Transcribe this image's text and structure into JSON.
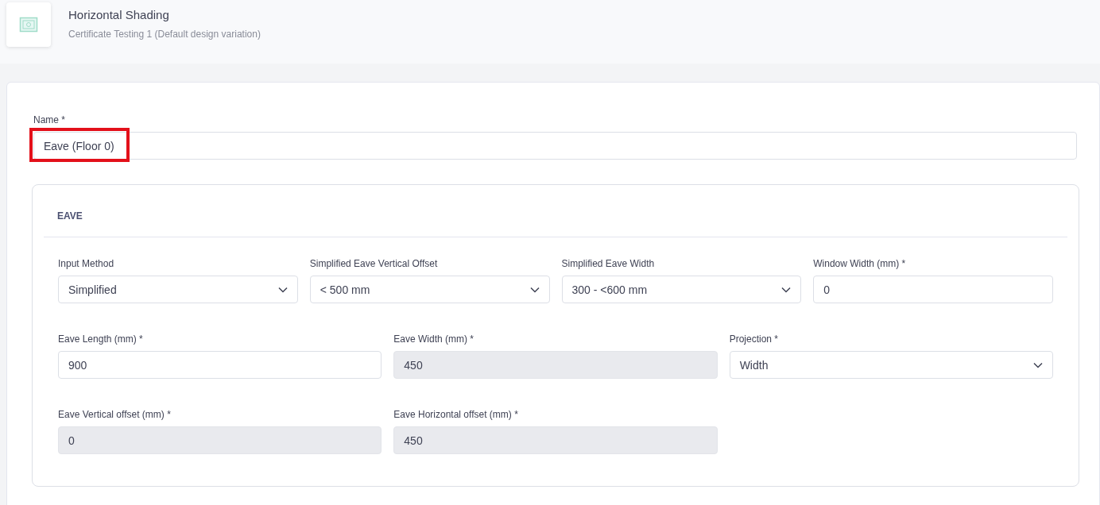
{
  "header": {
    "title": "Horizontal Shading",
    "subtitle": "Certificate Testing 1 (Default design variation)"
  },
  "name_field": {
    "label": "Name *",
    "value": "Eave (Floor 0)",
    "highlighted": true
  },
  "section": {
    "title": "EAVE",
    "rows": [
      {
        "fields": [
          {
            "kind": "select",
            "label": "Input Method",
            "value": "Simplified",
            "disabled": false
          },
          {
            "kind": "select",
            "label": "Simplified Eave Vertical Offset",
            "value": "< 500 mm",
            "disabled": false
          },
          {
            "kind": "select",
            "label": "Simplified Eave Width",
            "value": "300 - <600 mm",
            "disabled": false
          },
          {
            "kind": "input",
            "label": "Window Width (mm) *",
            "value": "0",
            "disabled": false
          }
        ]
      },
      {
        "fields": [
          {
            "kind": "input",
            "label": "Eave Length (mm) *",
            "value": "900",
            "disabled": false
          },
          {
            "kind": "input",
            "label": "Eave Width (mm) *",
            "value": "450",
            "disabled": true
          },
          {
            "kind": "select",
            "label": "Projection *",
            "value": "Width",
            "disabled": false
          }
        ]
      },
      {
        "fields": [
          {
            "kind": "input",
            "label": "Eave Vertical offset (mm) *",
            "value": "0",
            "disabled": true
          },
          {
            "kind": "input",
            "label": "Eave Horizontal offset (mm) *",
            "value": "450",
            "disabled": true
          }
        ]
      }
    ]
  }
}
